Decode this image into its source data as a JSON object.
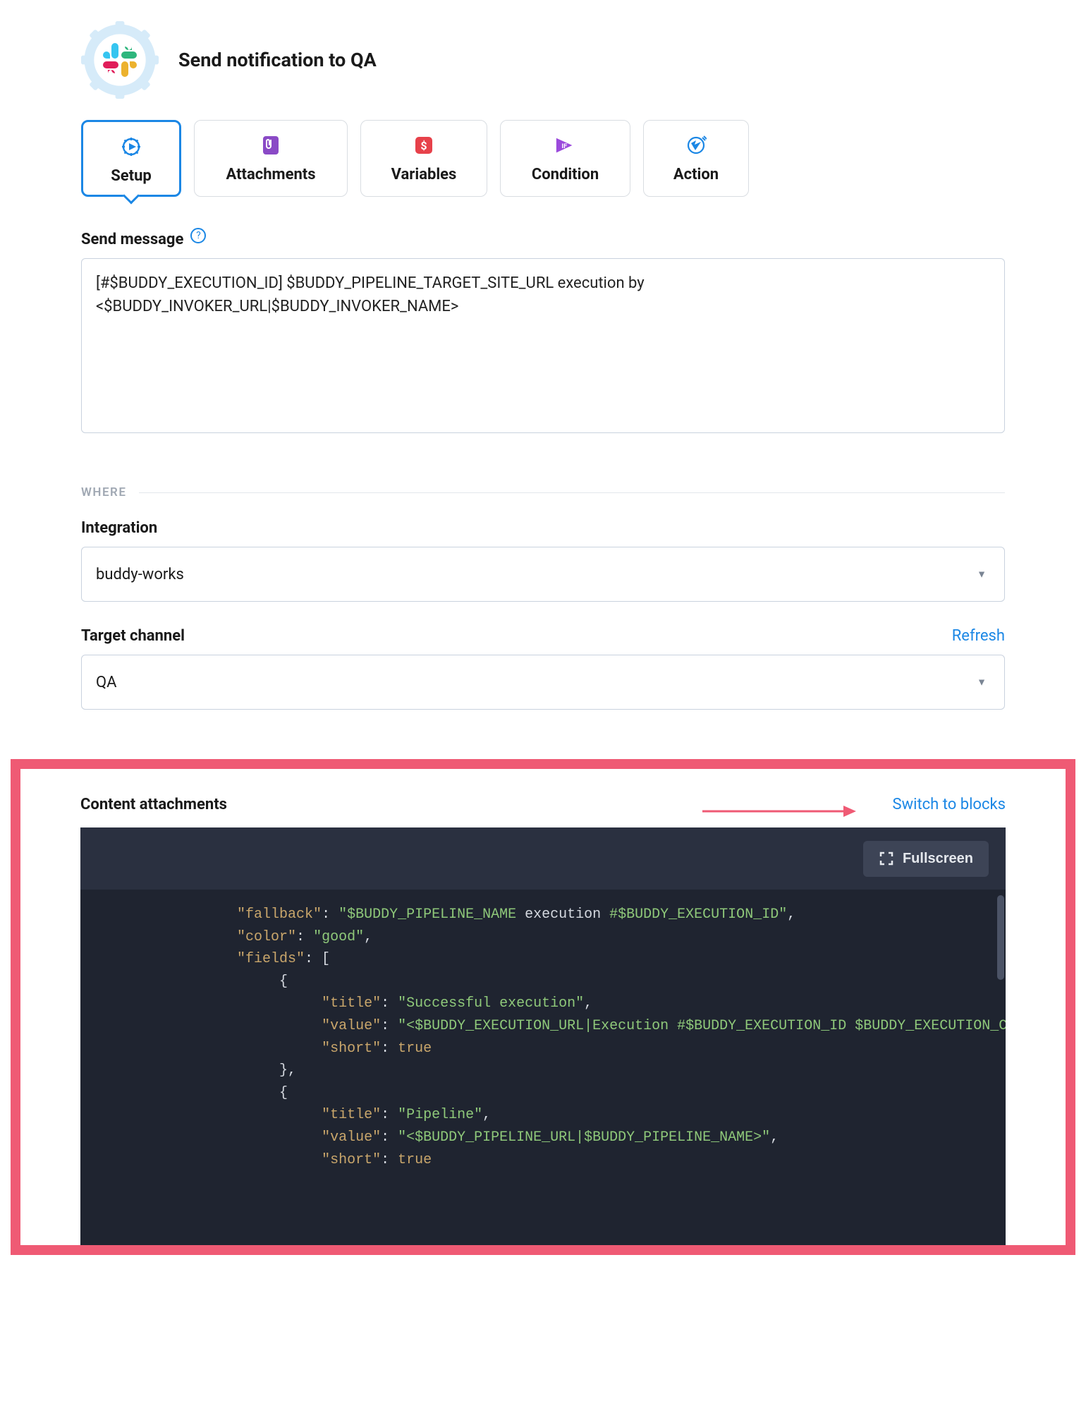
{
  "header": {
    "title": "Send notification to QA"
  },
  "tabs": [
    {
      "id": "setup",
      "label": "Setup",
      "active": true
    },
    {
      "id": "attachments",
      "label": "Attachments",
      "active": false
    },
    {
      "id": "variables",
      "label": "Variables",
      "active": false
    },
    {
      "id": "condition",
      "label": "Condition",
      "active": false
    },
    {
      "id": "action",
      "label": "Action",
      "active": false
    }
  ],
  "send_message": {
    "label": "Send message",
    "value": "[#$BUDDY_EXECUTION_ID] $BUDDY_PIPELINE_TARGET_SITE_URL execution by <$BUDDY_INVOKER_URL|$BUDDY_INVOKER_NAME>"
  },
  "where": {
    "label": "WHERE",
    "integration": {
      "label": "Integration",
      "value": "buddy-works"
    },
    "target_channel": {
      "label": "Target channel",
      "refresh": "Refresh",
      "value": "QA"
    }
  },
  "content_attachments": {
    "label": "Content attachments",
    "switch_link": "Switch to blocks",
    "fullscreen": "Fullscreen",
    "code_lines": [
      {
        "indent": 3,
        "tokens": [
          [
            "key",
            "\"fallback\""
          ],
          [
            "punc",
            ": "
          ],
          [
            "str",
            "\"$BUDDY_PIPELINE_NAME"
          ],
          [
            "kw",
            " execution "
          ],
          [
            "str",
            "#$BUDDY_EXECUTION_ID\""
          ],
          [
            "punc",
            ","
          ]
        ]
      },
      {
        "indent": 3,
        "tokens": [
          [
            "key",
            "\"color\""
          ],
          [
            "punc",
            ": "
          ],
          [
            "str",
            "\"good\""
          ],
          [
            "punc",
            ","
          ]
        ]
      },
      {
        "indent": 3,
        "tokens": [
          [
            "key",
            "\"fields\""
          ],
          [
            "punc",
            ": ["
          ]
        ]
      },
      {
        "indent": 4,
        "tokens": [
          [
            "punc",
            "{"
          ]
        ]
      },
      {
        "indent": 5,
        "tokens": [
          [
            "key",
            "\"title\""
          ],
          [
            "punc",
            ": "
          ],
          [
            "str",
            "\"Successful execution\""
          ],
          [
            "punc",
            ","
          ]
        ]
      },
      {
        "indent": 5,
        "tokens": [
          [
            "key",
            "\"value\""
          ],
          [
            "punc",
            ": "
          ],
          [
            "str",
            "\"<$BUDDY_EXECUTION_URL|Execution #$BUDDY_EXECUTION_ID $BUDDY_EXECUTION_C"
          ]
        ]
      },
      {
        "indent": 5,
        "tokens": [
          [
            "key",
            "\"short\""
          ],
          [
            "punc",
            ": "
          ],
          [
            "const",
            "true"
          ]
        ]
      },
      {
        "indent": 4,
        "tokens": [
          [
            "punc",
            "},"
          ]
        ]
      },
      {
        "indent": 4,
        "tokens": [
          [
            "punc",
            "{"
          ]
        ]
      },
      {
        "indent": 5,
        "tokens": [
          [
            "key",
            "\"title\""
          ],
          [
            "punc",
            ": "
          ],
          [
            "str",
            "\"Pipeline\""
          ],
          [
            "punc",
            ","
          ]
        ]
      },
      {
        "indent": 5,
        "tokens": [
          [
            "key",
            "\"value\""
          ],
          [
            "punc",
            ": "
          ],
          [
            "str",
            "\"<$BUDDY_PIPELINE_URL|$BUDDY_PIPELINE_NAME>\""
          ],
          [
            "punc",
            ","
          ]
        ]
      },
      {
        "indent": 5,
        "tokens": [
          [
            "key",
            "\"short\""
          ],
          [
            "punc",
            ": "
          ],
          [
            "const",
            "true"
          ]
        ]
      }
    ]
  },
  "colors": {
    "accent_blue": "#1b87e5",
    "highlight_border": "#ef5a74"
  }
}
